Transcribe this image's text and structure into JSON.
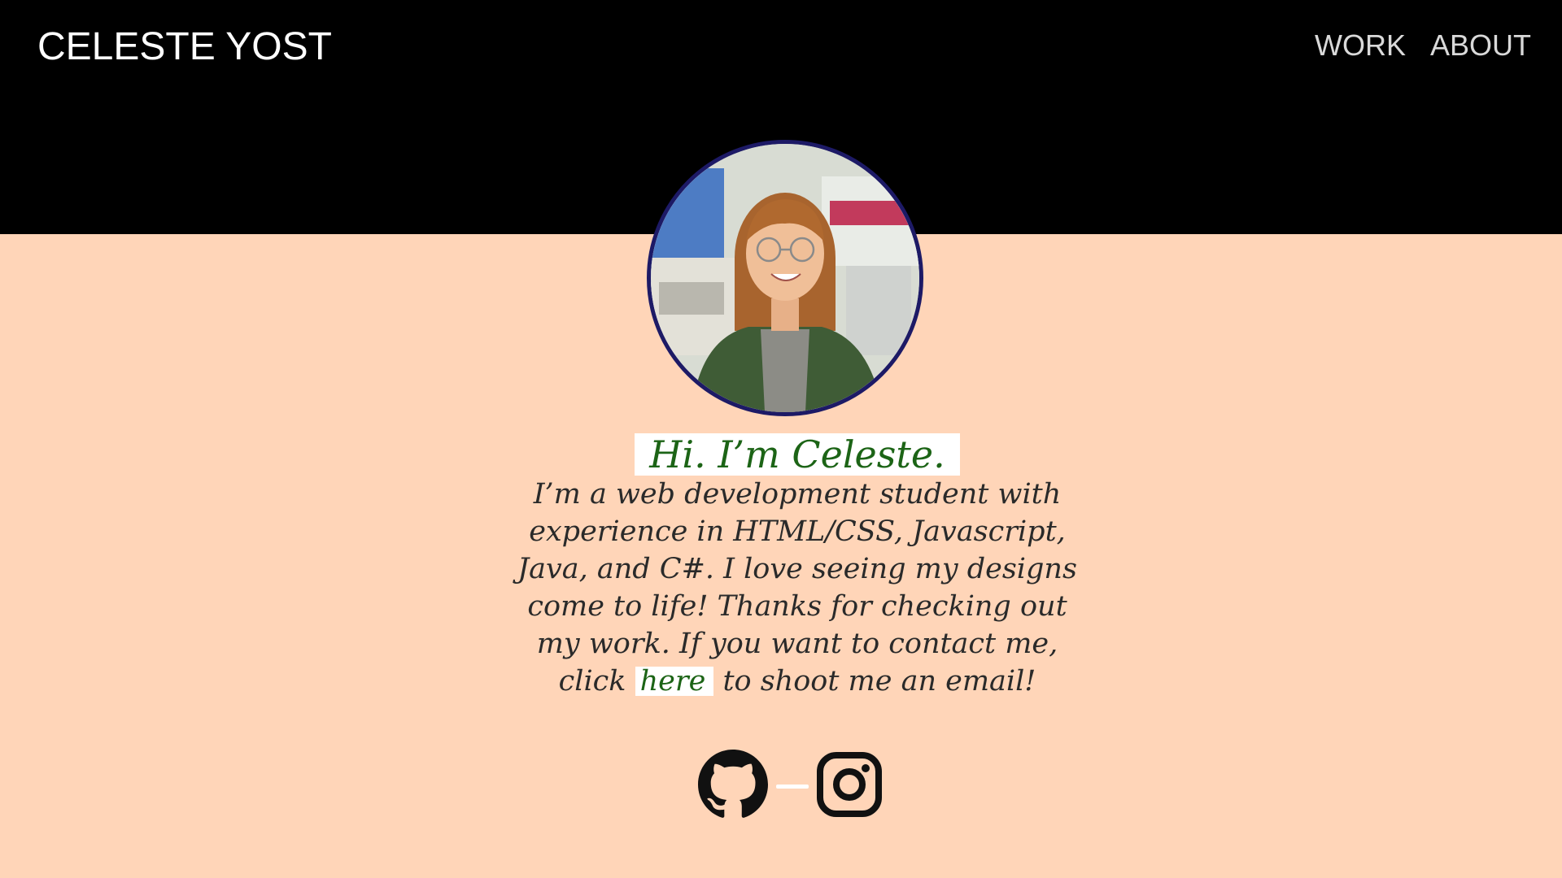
{
  "header": {
    "brand": "CELESTE YOST",
    "nav": [
      {
        "label": "WORK"
      },
      {
        "label": "ABOUT"
      }
    ]
  },
  "intro": {
    "greeting": "Hi. I’m Celeste.",
    "bio_before_link": "I’m a web development student with experience in HTML/CSS, Javascript, Java, and C#. I love seeing my designs come to life! Thanks for checking out my work. If you want to contact me, click",
    "link_text": "here",
    "bio_after_link": "to shoot me an email!"
  },
  "socials": [
    {
      "icon": "github-icon"
    },
    {
      "icon": "instagram-icon"
    }
  ],
  "colors": {
    "header_bg": "#000000",
    "page_bg": "#ffd5b8",
    "accent_green": "#1c6416",
    "avatar_border": "#1d1a66"
  }
}
